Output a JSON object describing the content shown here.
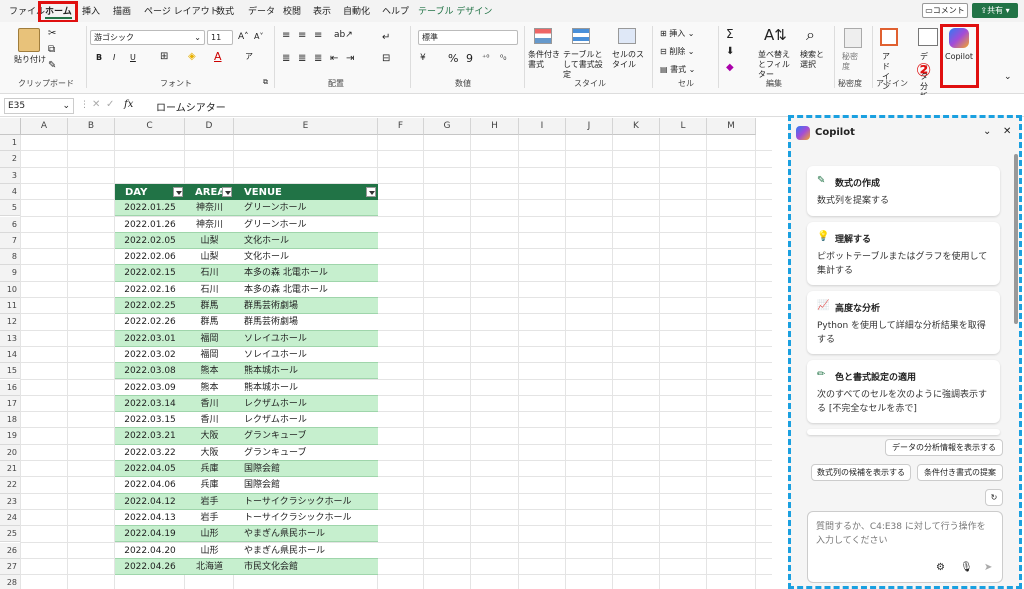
{
  "tabs": [
    "ファイル",
    "ホーム",
    "挿入",
    "描画",
    "ページ レイアウト",
    "数式",
    "データ",
    "校閲",
    "表示",
    "自動化",
    "ヘルプ",
    "テーブル デザイン"
  ],
  "title_actions": {
    "comment": "コメント",
    "share": "共有"
  },
  "annotations": {
    "one": "①",
    "two": "②"
  },
  "ribbon": {
    "clipboard": {
      "paste": "貼り付け",
      "label": "クリップボード"
    },
    "font": {
      "name": "游ゴシック",
      "size": "11",
      "bold": "B",
      "italic": "I",
      "underline": "U",
      "label": "フォント"
    },
    "align": {
      "label": "配置"
    },
    "number": {
      "format": "標準",
      "percent": "%",
      "comma": "9",
      "label": "数値"
    },
    "styles": {
      "cond": "条件付き書式",
      "table": "テーブルとして書式設定",
      "cell": "セルのスタイル",
      "label": "スタイル"
    },
    "cells": {
      "insert": "挿入",
      "delete": "削除",
      "format": "書式",
      "label": "セル"
    },
    "editing": {
      "sum": "Σ",
      "sort": "並べ替えとフィルター",
      "find": "検索と選択",
      "label": "編集"
    },
    "sensitivity": {
      "btn": "秘密度",
      "label": "秘密度"
    },
    "addin": {
      "btn": "アドイン",
      "label": "アドイン"
    },
    "analysis": {
      "btn": "データ分析"
    },
    "copilot": {
      "btn": "Copilot"
    }
  },
  "formula": {
    "namebox": "E35",
    "fx": "fx",
    "value": "ロームシアター"
  },
  "columns": [
    "A",
    "B",
    "C",
    "D",
    "E",
    "F",
    "G",
    "H",
    "I",
    "J",
    "K",
    "L",
    "M"
  ],
  "table": {
    "headers": [
      "DAY",
      "AREA",
      "VENUE"
    ],
    "rows": [
      [
        "2022.01.25",
        "神奈川",
        "グリーンホール"
      ],
      [
        "2022.01.26",
        "神奈川",
        "グリーンホール"
      ],
      [
        "2022.02.05",
        "山梨",
        "文化ホール"
      ],
      [
        "2022.02.06",
        "山梨",
        "文化ホール"
      ],
      [
        "2022.02.15",
        "石川",
        "本多の森 北電ホール"
      ],
      [
        "2022.02.16",
        "石川",
        "本多の森 北電ホール"
      ],
      [
        "2022.02.25",
        "群馬",
        "群馬芸術劇場"
      ],
      [
        "2022.02.26",
        "群馬",
        "群馬芸術劇場"
      ],
      [
        "2022.03.01",
        "福岡",
        "ソレイユホール"
      ],
      [
        "2022.03.02",
        "福岡",
        "ソレイユホール"
      ],
      [
        "2022.03.08",
        "熊本",
        "熊本城ホール"
      ],
      [
        "2022.03.09",
        "熊本",
        "熊本城ホール"
      ],
      [
        "2022.03.14",
        "香川",
        "レクザムホール"
      ],
      [
        "2022.03.15",
        "香川",
        "レクザムホール"
      ],
      [
        "2022.03.21",
        "大阪",
        "グランキューブ"
      ],
      [
        "2022.03.22",
        "大阪",
        "グランキューブ"
      ],
      [
        "2022.04.05",
        "兵庫",
        "国際会館"
      ],
      [
        "2022.04.06",
        "兵庫",
        "国際会館"
      ],
      [
        "2022.04.12",
        "岩手",
        "トーサイクラシックホール"
      ],
      [
        "2022.04.13",
        "岩手",
        "トーサイクラシックホール"
      ],
      [
        "2022.04.19",
        "山形",
        "やまぎん県民ホール"
      ],
      [
        "2022.04.20",
        "山形",
        "やまぎん県民ホール"
      ],
      [
        "2022.04.26",
        "北海道",
        "市民文化会館"
      ]
    ]
  },
  "copilot": {
    "title": "Copilot",
    "cards": [
      {
        "title": "数式の作成",
        "desc": "数式列を提案する"
      },
      {
        "title": "理解する",
        "desc": "ピボットテーブルまたはグラフを使用して集計する"
      },
      {
        "title": "高度な分析",
        "desc": "Python を使用して詳細な分析結果を取得する"
      },
      {
        "title": "色と書式設定の適用",
        "desc": "次のすべてのセルを次のように強調表示する [不完全なセルを赤で]"
      }
    ],
    "chips": [
      "データの分析情報を表示する",
      "数式列の候補を表示する",
      "条件付き書式の提案"
    ],
    "input_placeholder": "質問するか、C4:E38 に対して行う操作を入力してください"
  },
  "colors": {
    "accent": "#217346",
    "table_band": "#c6efce",
    "highlight": "#e01010",
    "copilot_border": "#1aa0e0"
  }
}
